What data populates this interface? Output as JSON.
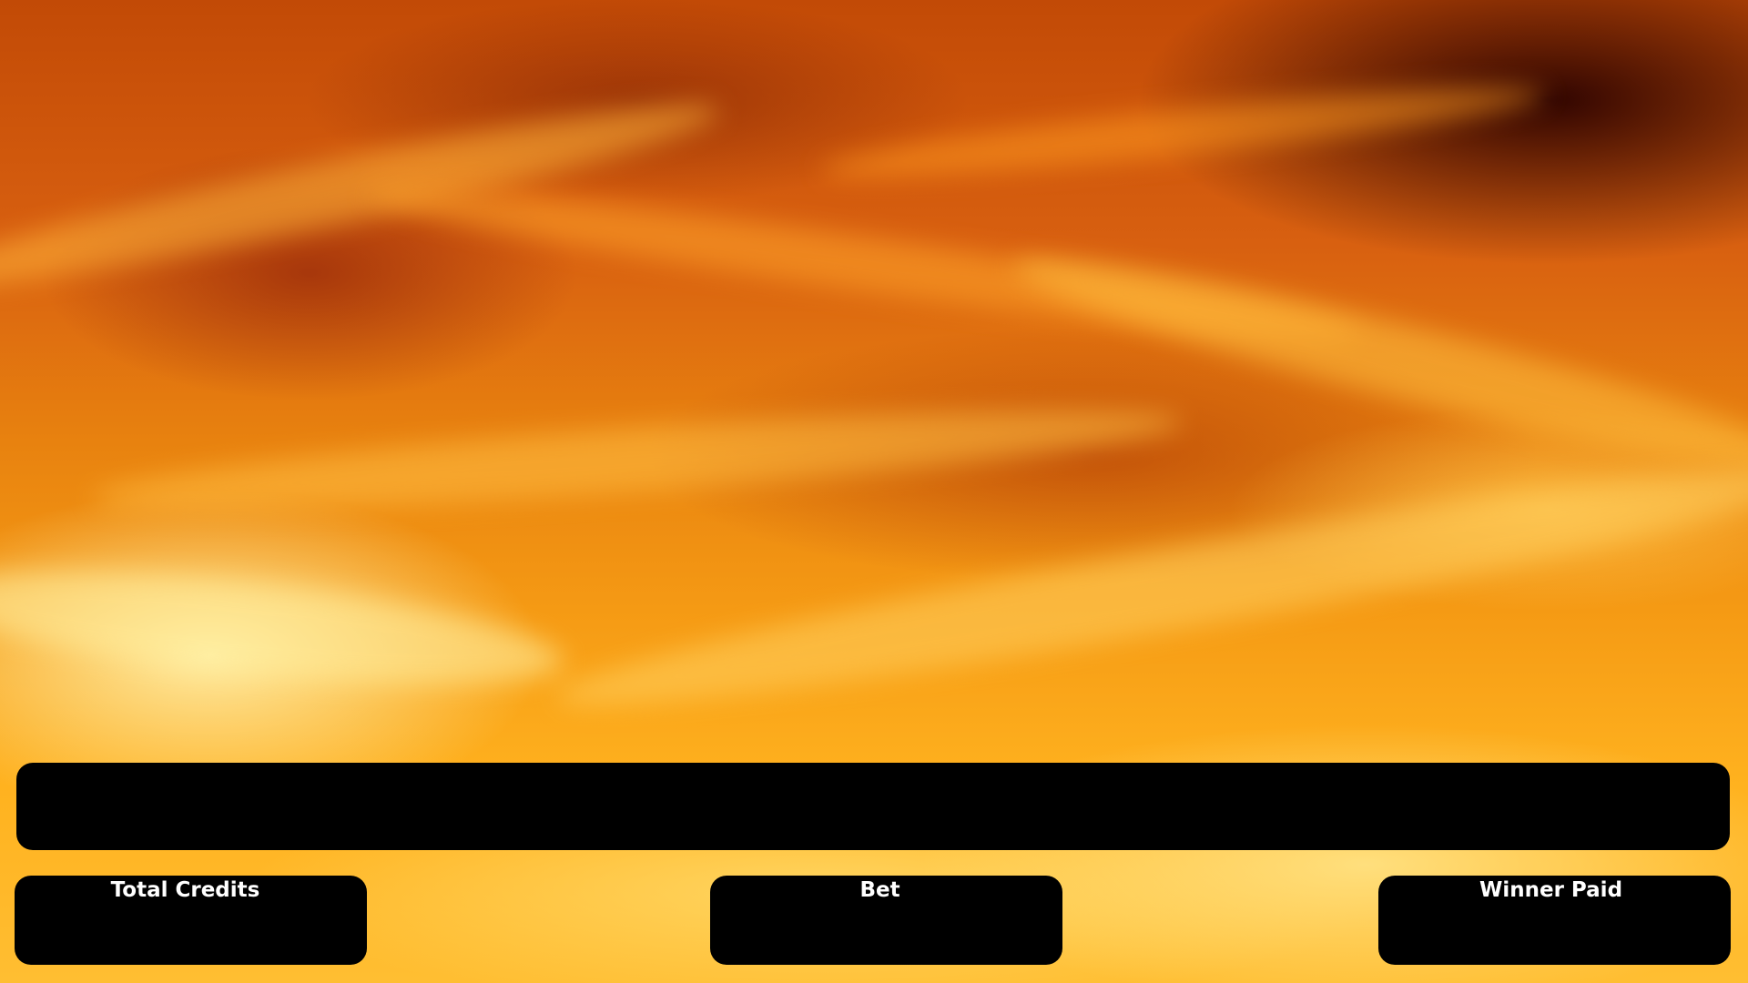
{
  "game": {
    "background": "fire",
    "message": ""
  },
  "meters": {
    "total_credits": {
      "label": "Total Credits",
      "value": ""
    },
    "bet": {
      "label": "Bet",
      "value": ""
    },
    "winner_paid": {
      "label": "Winner Paid",
      "value": ""
    }
  },
  "colors": {
    "panel": "#000000",
    "text": "#ffffff",
    "fire_accent": "#f59a14"
  }
}
